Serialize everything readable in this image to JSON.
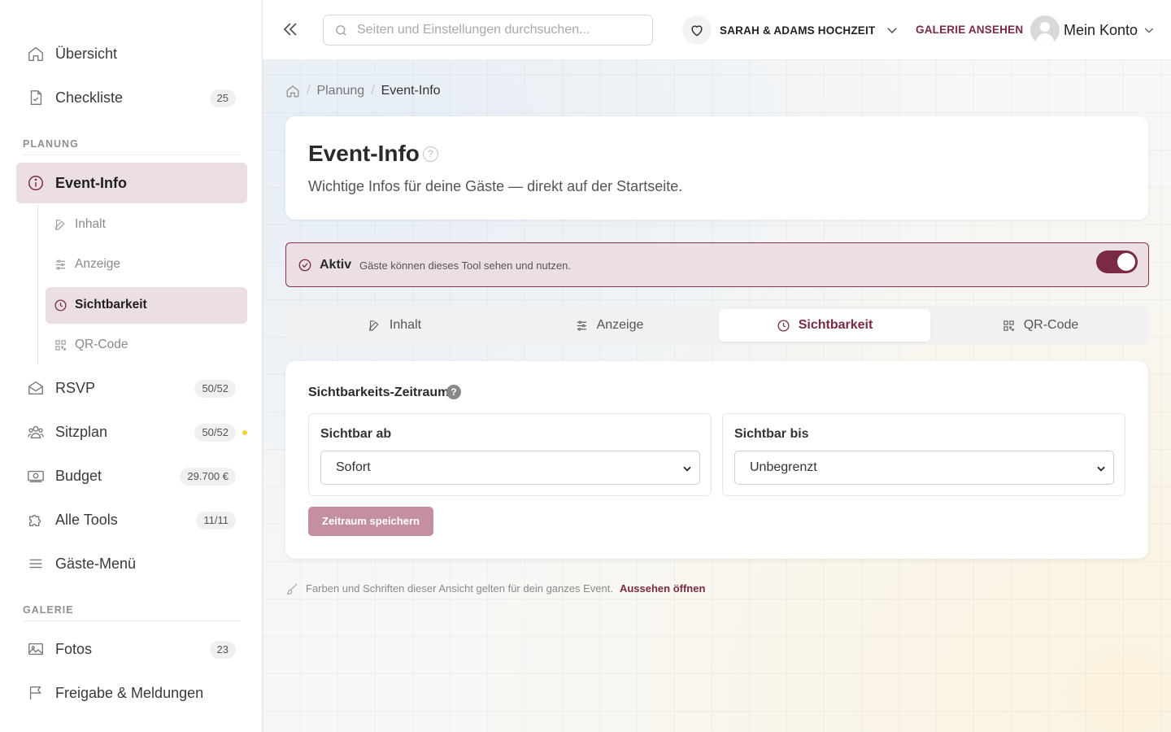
{
  "sidebar": {
    "items": [
      {
        "label": "Übersicht",
        "icon": "home-icon"
      },
      {
        "label": "Checkliste",
        "badge": "25",
        "icon": "checklist-icon"
      }
    ],
    "planning_label": "PLANUNG",
    "event_info": {
      "label": "Event-Info",
      "icon": "info-icon"
    },
    "sub_items": [
      {
        "label": "Inhalt",
        "icon": "edit-icon"
      },
      {
        "label": "Anzeige",
        "icon": "sliders-icon"
      },
      {
        "label": "Sichtbarkeit",
        "icon": "clock-icon"
      },
      {
        "label": "QR-Code",
        "icon": "qr-icon"
      }
    ],
    "planning_items": [
      {
        "label": "RSVP",
        "badge": "50/52",
        "icon": "envelope-icon"
      },
      {
        "label": "Sitzplan",
        "badge": "50/52",
        "icon": "people-icon"
      },
      {
        "label": "Budget",
        "badge": "29.700 €",
        "icon": "money-icon"
      },
      {
        "label": "Alle Tools",
        "badge": "11/11",
        "icon": "puzzle-icon"
      },
      {
        "label": "Gäste-Menü",
        "icon": "menu-icon"
      }
    ],
    "gallery_label": "GALERIE",
    "gallery_items": [
      {
        "label": "Fotos",
        "badge": "23",
        "icon": "image-icon"
      },
      {
        "label": "Freigabe & Meldungen",
        "icon": "flag-icon"
      }
    ]
  },
  "topbar": {
    "search_placeholder": "Seiten und Einstellungen durchsuchen...",
    "event_name": "SARAH & ADAMS HOCHZEIT",
    "gallery_link": "GALERIE ANSEHEN",
    "account_label": "Mein Konto"
  },
  "breadcrumb": {
    "planning": "Planung",
    "current": "Event-Info",
    "sep": "/"
  },
  "header": {
    "title": "Event-Info",
    "help": "?",
    "subtitle": "Wichtige Infos für deine Gäste — direkt auf der Startseite."
  },
  "status": {
    "label": "Aktiv",
    "description": "Gäste können dieses Tool sehen und nutzen.",
    "enabled": true
  },
  "tabs": [
    {
      "label": "Inhalt",
      "icon": "edit-icon"
    },
    {
      "label": "Anzeige",
      "icon": "sliders-icon"
    },
    {
      "label": "Sichtbarkeit",
      "icon": "clock-icon",
      "active": true
    },
    {
      "label": "QR-Code",
      "icon": "qr-icon"
    }
  ],
  "visibility": {
    "title": "Sichtbarkeits-Zeitraum",
    "help": "?",
    "from_label": "Sichtbar ab",
    "from_value": "Sofort",
    "until_label": "Sichtbar bis",
    "until_value": "Unbegrenzt",
    "save_label": "Zeitraum speichern"
  },
  "footnote": {
    "text": "Farben und Schriften dieser Ansicht gelten für dein ganzes Event.",
    "link": "Aussehen öffnen"
  },
  "colors": {
    "accent": "#7a2a45",
    "accent_light": "#ecdfe3",
    "badge_dot": "#f2d331"
  }
}
